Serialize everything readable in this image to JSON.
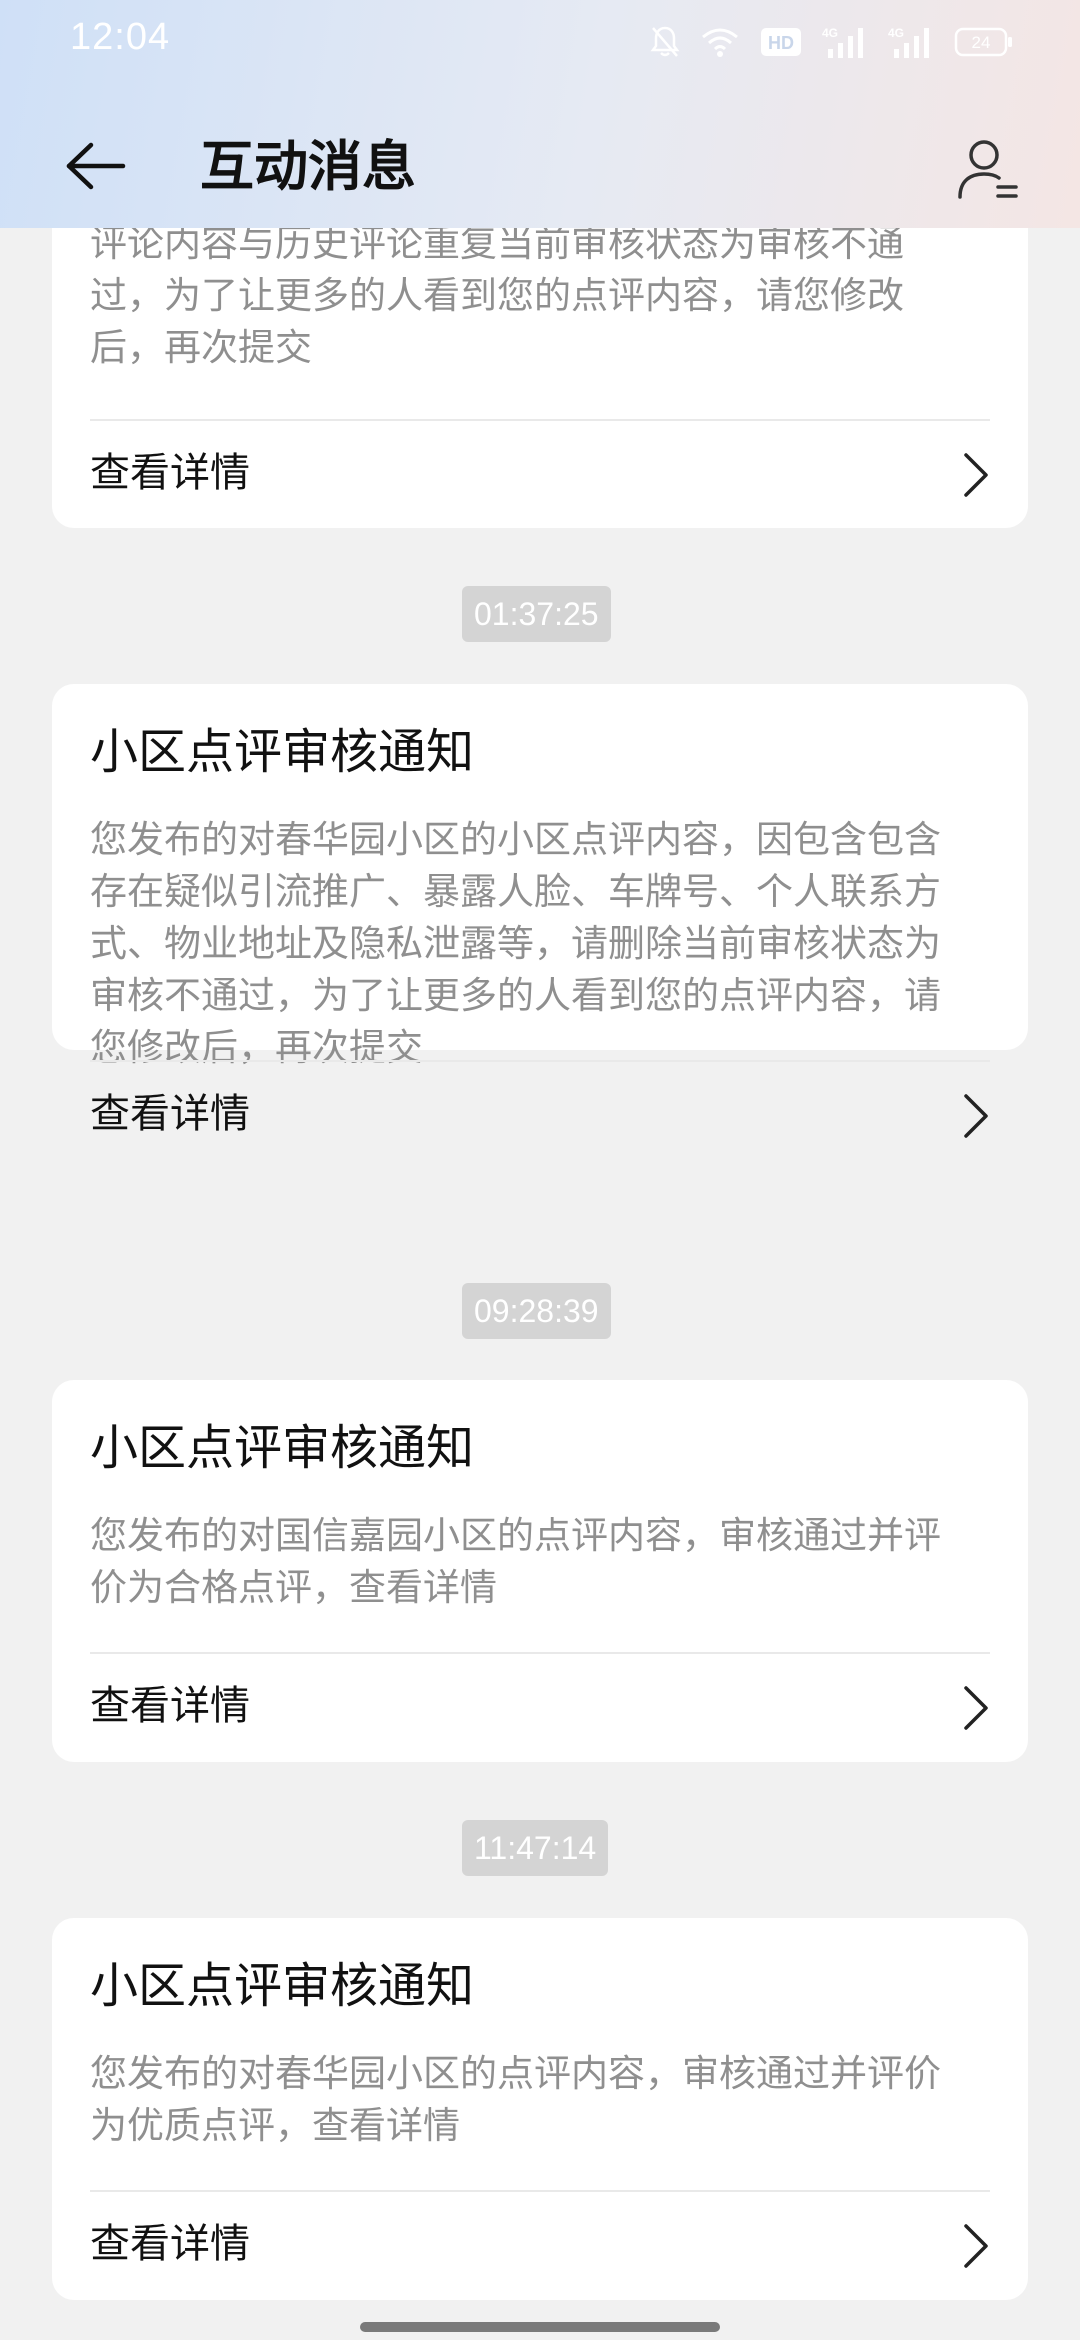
{
  "status_bar": {
    "time": "12:04",
    "hd_badge": "HD",
    "signal_1": "4G",
    "signal_2": "4G",
    "battery": "24",
    "icons": [
      "bell-off-icon",
      "wifi-icon",
      "hd-icon",
      "signal-4g-icon",
      "signal-4g-icon",
      "battery-icon"
    ]
  },
  "header": {
    "title": "互动消息",
    "back_icon": "arrow-left-icon",
    "profile_icon": "user-settings-icon"
  },
  "messages": [
    {
      "timestamp": "",
      "title": "",
      "body": "评论内容与历史评论重复当前审核状态为审核不通过，为了让更多的人看到您的点评内容，请您修改后，再次提交",
      "body_lines": [
        "评论内容与历史评论重复当前审核状态为审核不通",
        "过，为了让更多的人看到您的点评内容，请您修改",
        "后，再次提交"
      ],
      "detail_label": "查看详情"
    },
    {
      "timestamp": "01:37:25",
      "title": "小区点评审核通知",
      "body_lines": [
        "您发布的对春华园小区的小区点评内容，因包含包含",
        "存在疑似引流推广、暴露人脸、车牌号、个人联系方",
        "式、物业地址及隐私泄露等，请删除当前审核状态为",
        "审核不通过，为了让更多的人看到您的点评内容，请",
        "您修改后，再次提交"
      ],
      "detail_label": "查看详情"
    },
    {
      "timestamp": "09:28:39",
      "title": "小区点评审核通知",
      "body_lines": [
        "您发布的对国信嘉园小区的点评内容，审核通过并评",
        "价为合格点评，查看详情"
      ],
      "detail_label": "查看详情"
    },
    {
      "timestamp": "11:47:14",
      "title": "小区点评审核通知",
      "body_lines": [
        "您发布的对春华园小区的点评内容，审核通过并评价",
        "为优质点评，查看详情"
      ],
      "detail_label": "查看详情"
    }
  ],
  "colors": {
    "background": "#f1f1f1",
    "card": "#ffffff",
    "title_text": "#111111",
    "body_text": "#8f8f8f",
    "time_badge": "#d4d4d4"
  }
}
